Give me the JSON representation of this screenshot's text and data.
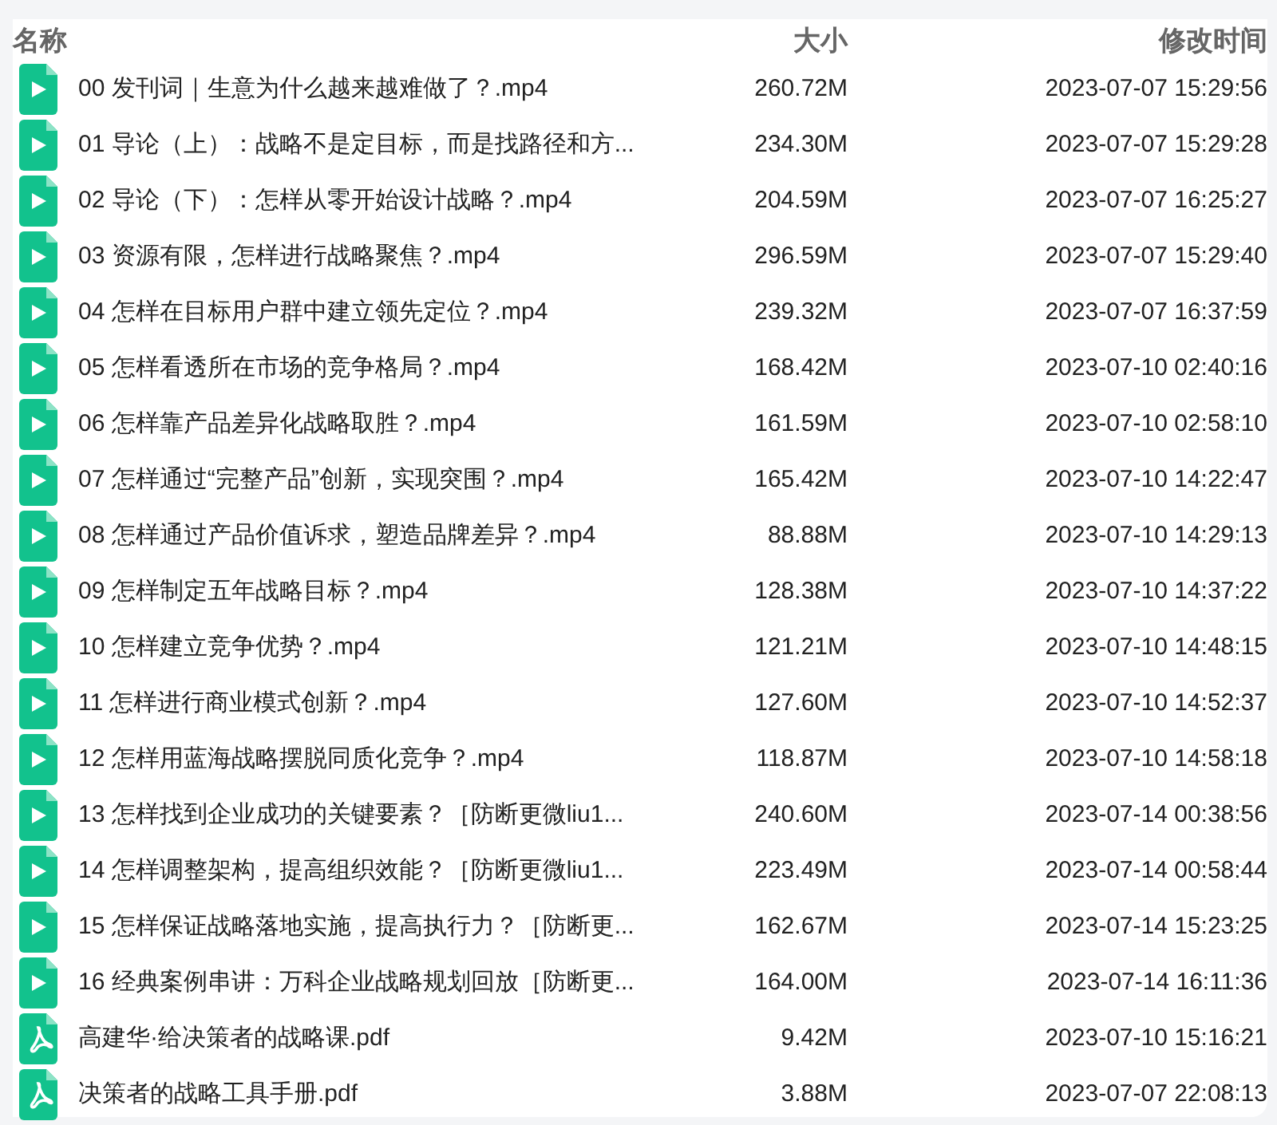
{
  "columns": [
    "名称",
    "大小",
    "修改时间"
  ],
  "files": [
    {
      "kind": "video",
      "name": "00 发刊词｜生意为什么越来越难做了？.mp4",
      "size": "260.72M",
      "modified": "2023-07-07 15:29:56"
    },
    {
      "kind": "video",
      "name": "01 导论（上）：战略不是定目标，而是找路径和方...",
      "size": "234.30M",
      "modified": "2023-07-07 15:29:28"
    },
    {
      "kind": "video",
      "name": "02 导论（下）：怎样从零开始设计战略？.mp4",
      "size": "204.59M",
      "modified": "2023-07-07 16:25:27"
    },
    {
      "kind": "video",
      "name": "03 资源有限，怎样进行战略聚焦？.mp4",
      "size": "296.59M",
      "modified": "2023-07-07 15:29:40"
    },
    {
      "kind": "video",
      "name": "04 怎样在目标用户群中建立领先定位？.mp4",
      "size": "239.32M",
      "modified": "2023-07-07 16:37:59"
    },
    {
      "kind": "video",
      "name": "05 怎样看透所在市场的竞争格局？.mp4",
      "size": "168.42M",
      "modified": "2023-07-10 02:40:16"
    },
    {
      "kind": "video",
      "name": "06 怎样靠产品差异化战略取胜？.mp4",
      "size": "161.59M",
      "modified": "2023-07-10 02:58:10"
    },
    {
      "kind": "video",
      "name": "07 怎样通过“完整产品”创新，实现突围？.mp4",
      "size": "165.42M",
      "modified": "2023-07-10 14:22:47"
    },
    {
      "kind": "video",
      "name": "08 怎样通过产品价值诉求，塑造品牌差异？.mp4",
      "size": "88.88M",
      "modified": "2023-07-10 14:29:13"
    },
    {
      "kind": "video",
      "name": "09 怎样制定五年战略目标？.mp4",
      "size": "128.38M",
      "modified": "2023-07-10 14:37:22"
    },
    {
      "kind": "video",
      "name": "10 怎样建立竞争优势？.mp4",
      "size": "121.21M",
      "modified": "2023-07-10 14:48:15"
    },
    {
      "kind": "video",
      "name": "11 怎样进行商业模式创新？.mp4",
      "size": "127.60M",
      "modified": "2023-07-10 14:52:37"
    },
    {
      "kind": "video",
      "name": "12 怎样用蓝海战略摆脱同质化竞争？.mp4",
      "size": "118.87M",
      "modified": "2023-07-10 14:58:18"
    },
    {
      "kind": "video",
      "name": "13 怎样找到企业成功的关键要素？［防断更微liu1...",
      "size": "240.60M",
      "modified": "2023-07-14 00:38:56"
    },
    {
      "kind": "video",
      "name": "14 怎样调整架构，提高组织效能？［防断更微liu1...",
      "size": "223.49M",
      "modified": "2023-07-14 00:58:44"
    },
    {
      "kind": "video",
      "name": "15 怎样保证战略落地实施，提高执行力？［防断更...",
      "size": "162.67M",
      "modified": "2023-07-14 15:23:25"
    },
    {
      "kind": "video",
      "name": "16 经典案例串讲：万科企业战略规划回放［防断更...",
      "size": "164.00M",
      "modified": "2023-07-14 16:11:36"
    },
    {
      "kind": "pdf",
      "name": "高建华·给决策者的战略课.pdf",
      "size": "9.42M",
      "modified": "2023-07-10 15:16:21"
    },
    {
      "kind": "pdf",
      "name": "决策者的战略工具手册.pdf",
      "size": "3.88M",
      "modified": "2023-07-07 22:08:13"
    }
  ]
}
